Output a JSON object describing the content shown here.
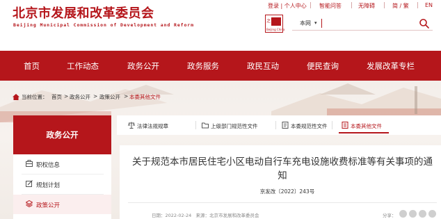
{
  "site": {
    "title_cn": "北京市发展和改革委员会",
    "title_en": "Beijing Municipal Commission of Development and Reform"
  },
  "top_links": [
    "登录 | 个人中心",
    "智能问答",
    "无障碍",
    "简 / 繁",
    "EN"
  ],
  "seal": {
    "chars": "之首",
    "caption": "Beijing China"
  },
  "search": {
    "scope": "本网",
    "value": ""
  },
  "nav": [
    "首页",
    "工作动态",
    "政务公开",
    "政务服务",
    "政民互动",
    "便民查询",
    "发展改革专栏"
  ],
  "breadcrumb": {
    "prefix": "当前位置：",
    "items": [
      "首页",
      "政务公开",
      "政策公开",
      "本委其他文件"
    ],
    "separator": ">"
  },
  "sidebar": {
    "title": "政务公开",
    "items": [
      {
        "label": "职权信息",
        "icon": "briefcase-icon"
      },
      {
        "label": "规划计划",
        "icon": "edit-icon"
      },
      {
        "label": "政策公开",
        "icon": "layers-icon"
      }
    ],
    "active_index": 2
  },
  "tabs": {
    "items": [
      {
        "label": "法律法规规章",
        "icon": "scales-icon"
      },
      {
        "label": "上级部门规范性文件",
        "icon": "folder-icon"
      },
      {
        "label": "本委规范性文件",
        "icon": "document-icon"
      },
      {
        "label": "本委其他文件",
        "icon": "document-list-icon"
      }
    ],
    "active_index": 3
  },
  "article": {
    "title": "关于规范本市居民住宅小区电动自行车充电设施收费标准等有关事项的通知",
    "doc_number": "京发改〔2022〕243号",
    "date_label": "日期：",
    "date": "2022-02-24",
    "source_label": "来源：",
    "source": "北京市发展和改革委员会",
    "share_label": "分享："
  },
  "colors": {
    "brand_red": "#b5161b",
    "text": "#333333",
    "muted": "#888888"
  }
}
